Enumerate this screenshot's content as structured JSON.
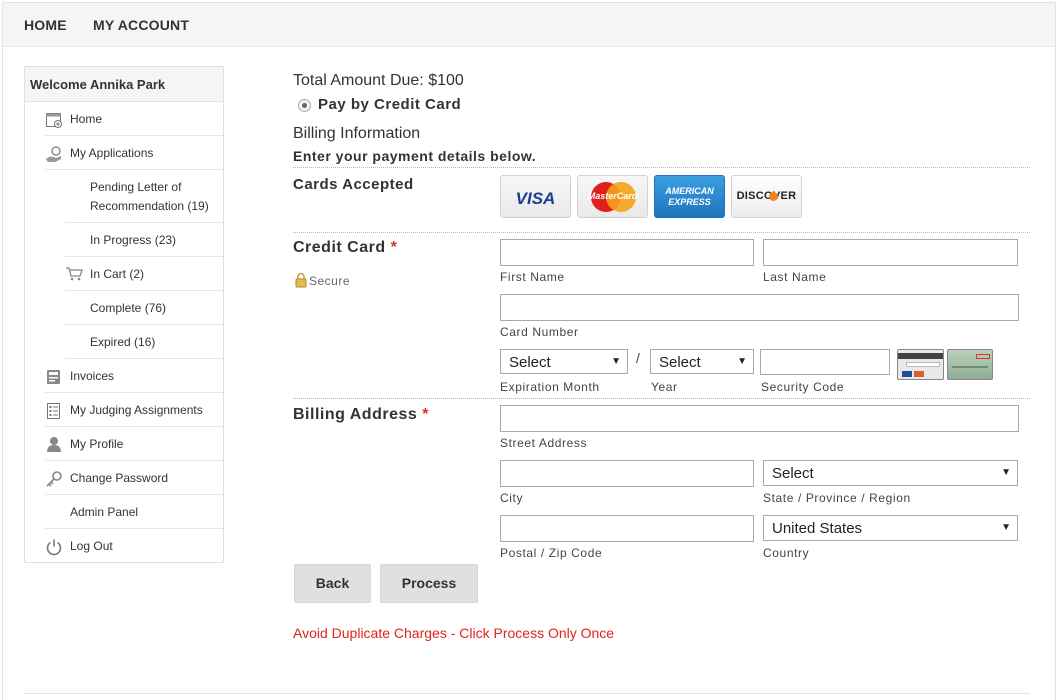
{
  "topnav": {
    "home": "HOME",
    "account": "MY ACCOUNT"
  },
  "sidebar": {
    "welcome": "Welcome Annika Park",
    "items": [
      {
        "label": "Home",
        "icon": "home-icon"
      },
      {
        "label": "My Applications",
        "icon": "applications-icon"
      },
      {
        "label": "Pending Letter of",
        "label2": "Recommendation (19)"
      },
      {
        "label": "In Progress (23)"
      },
      {
        "label": "In Cart (2)",
        "icon": "cart-icon"
      },
      {
        "label": "Complete (76)"
      },
      {
        "label": "Expired (16)"
      },
      {
        "label": "Invoices",
        "icon": "invoice-icon"
      },
      {
        "label": "My Judging Assignments",
        "icon": "judging-icon"
      },
      {
        "label": "My Profile",
        "icon": "profile-icon"
      },
      {
        "label": "Change Password",
        "icon": "key-icon"
      },
      {
        "label": "Admin Panel"
      },
      {
        "label": "Log Out",
        "icon": "power-icon"
      }
    ]
  },
  "payment": {
    "total": "Total Amount Due: $100",
    "method": "Pay by Credit Card",
    "billing_info": "Billing Information",
    "instructions": "Enter your payment details below.",
    "cards_accepted": "Cards Accepted",
    "cards": [
      "VISA",
      "MasterCard",
      "AMERICAN EXPRESS",
      "DISCOVER"
    ],
    "credit_card_label": "Credit Card",
    "required_mark": "*",
    "secure": "Secure",
    "first_name": "First Name",
    "last_name": "Last Name",
    "card_number": "Card Number",
    "exp_month_value": "Select",
    "exp_year_value": "Select",
    "slash": "/",
    "expiration_month": "Expiration Month",
    "year": "Year",
    "security_code": "Security Code",
    "billing_address_label": "Billing Address",
    "street_address": "Street Address",
    "city": "City",
    "state_value": "Select",
    "state": "State / Province / Region",
    "postal": "Postal / Zip Code",
    "country_value": "United States",
    "country": "Country",
    "back": "Back",
    "process": "Process",
    "warning": "Avoid Duplicate Charges - Click Process Only Once"
  },
  "colors": {
    "required": "#d9302f",
    "warning": "#e0241b",
    "button": "#e0e0e0"
  }
}
